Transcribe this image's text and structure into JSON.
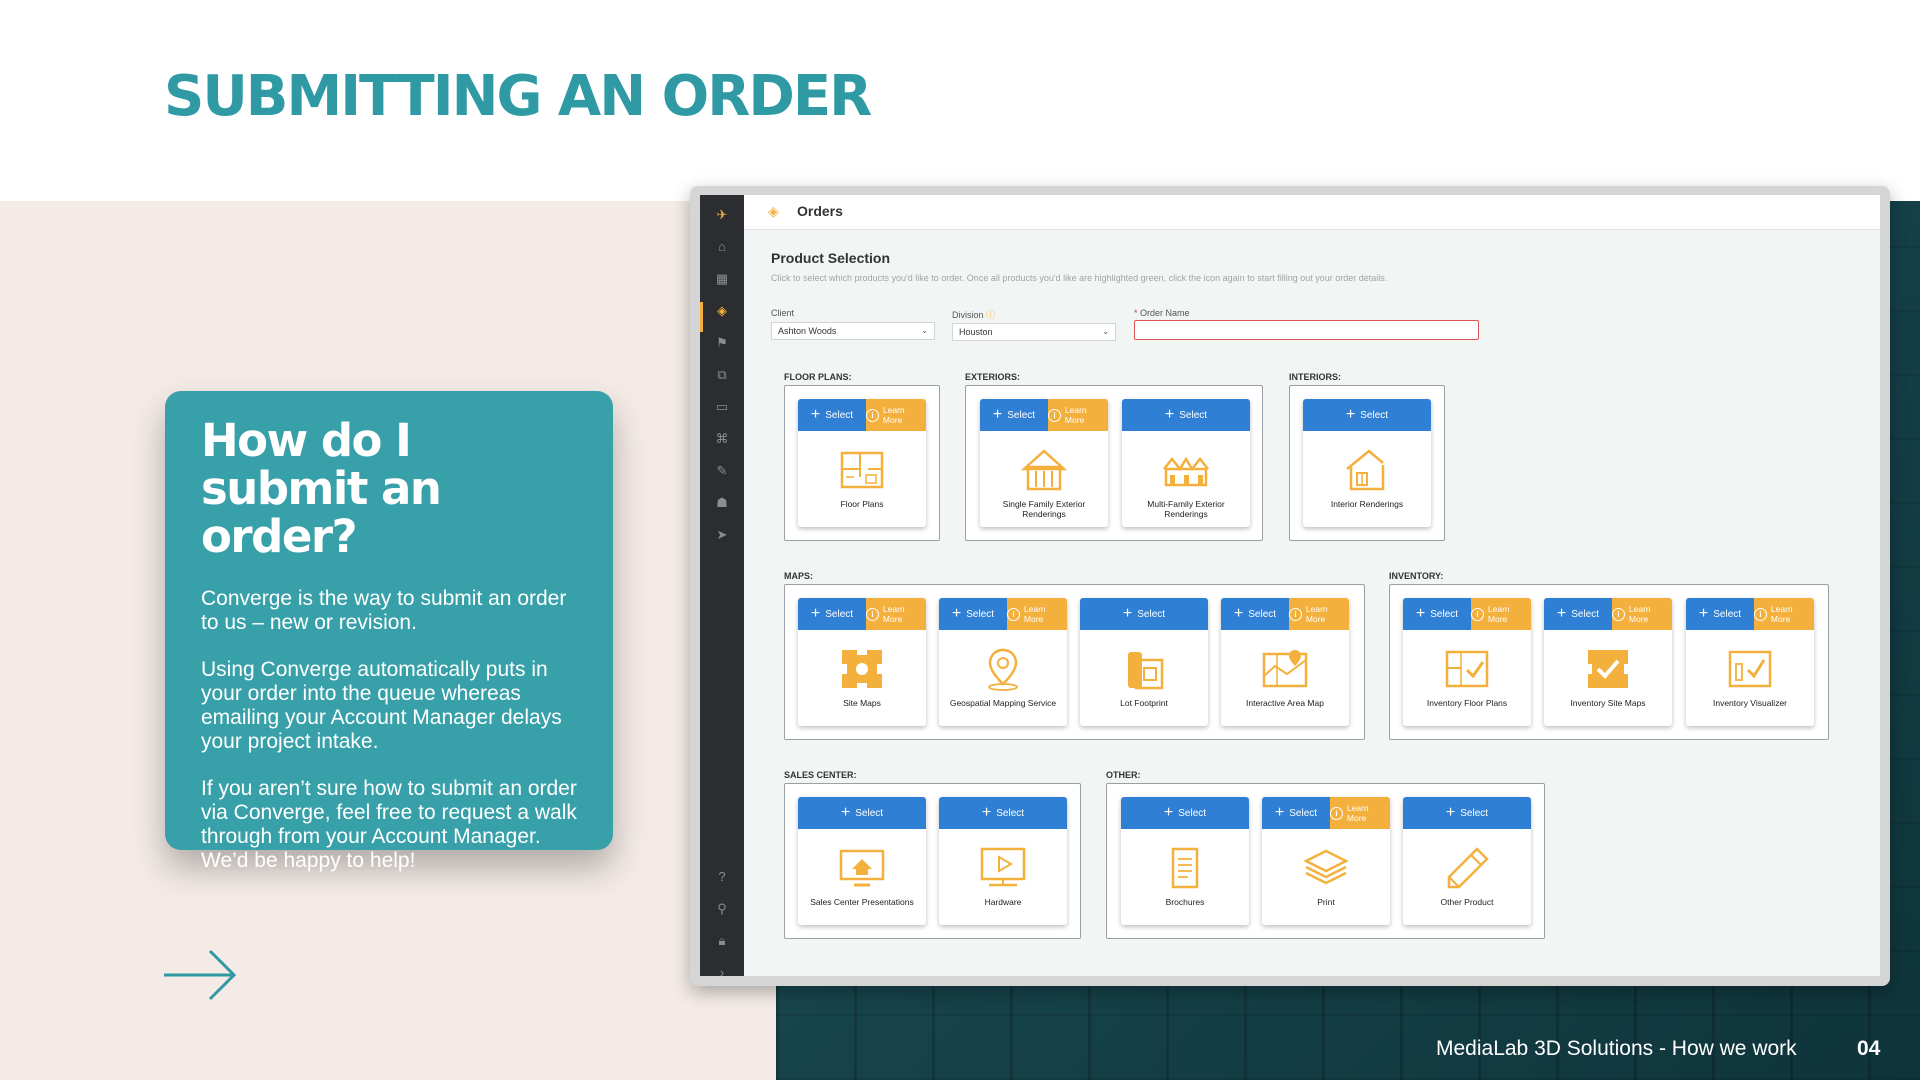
{
  "slide": {
    "title": "SUBMITTING AN ORDER",
    "footer": "MediaLab 3D Solutions - How we work",
    "page_number": "04"
  },
  "info_card": {
    "heading": "How do I submit an order?",
    "paragraphs": [
      "Converge is the way to submit an order to us – new or revision.",
      "Using Converge automatically puts in your order into the queue whereas emailing your Account Manager delays your project intake.",
      "If you aren’t sure how to submit an order via Converge, feel free to request a walk through from your Account Manager. We’d be happy to help!"
    ]
  },
  "app": {
    "page_title": "Orders",
    "section_title": "Product Selection",
    "instructions": "Click to select which products you'd like to order. Once all products you'd like are highlighted green, click the icon again to start filling out your order details.",
    "form": {
      "client_label": "Client",
      "client_value": "Ashton Woods",
      "division_label": "Division",
      "division_value": "Houston",
      "order_name_label": "Order Name",
      "order_name_value": ""
    },
    "select_label": "Select",
    "learn_label": "Learn More",
    "groups": {
      "floor_plans": {
        "label": "FLOOR PLANS:",
        "products": [
          {
            "name": "Floor Plans",
            "learn": true,
            "icon": "floor-plan-icon"
          }
        ]
      },
      "exteriors": {
        "label": "EXTERIORS:",
        "products": [
          {
            "name": "Single Family Exterior Renderings",
            "learn": true,
            "icon": "single-family-icon"
          },
          {
            "name": "Multi-Family Exterior Renderings",
            "learn": false,
            "icon": "multi-family-icon"
          }
        ]
      },
      "interiors": {
        "label": "INTERIORS:",
        "products": [
          {
            "name": "Interior Renderings",
            "learn": false,
            "icon": "interior-icon"
          }
        ]
      },
      "maps": {
        "label": "MAPS:",
        "products": [
          {
            "name": "Site Maps",
            "learn": true,
            "icon": "site-map-icon"
          },
          {
            "name": "Geospatial Mapping Service",
            "learn": true,
            "icon": "geospatial-icon"
          },
          {
            "name": "Lot Footprint",
            "learn": false,
            "icon": "lot-footprint-icon"
          },
          {
            "name": "Interactive Area Map",
            "learn": true,
            "icon": "interactive-map-icon"
          }
        ]
      },
      "inventory": {
        "label": "INVENTORY:",
        "products": [
          {
            "name": "Inventory Floor Plans",
            "learn": true,
            "icon": "inventory-floor-plan-icon"
          },
          {
            "name": "Inventory Site Maps",
            "learn": true,
            "icon": "inventory-site-map-icon"
          },
          {
            "name": "Inventory Visualizer",
            "learn": true,
            "icon": "inventory-visualizer-icon"
          }
        ]
      },
      "sales_center": {
        "label": "SALES CENTER:",
        "products": [
          {
            "name": "Sales Center Presentations",
            "learn": false,
            "icon": "presentation-icon"
          },
          {
            "name": "Hardware",
            "learn": false,
            "icon": "hardware-icon"
          }
        ]
      },
      "other": {
        "label": "OTHER:",
        "products": [
          {
            "name": "Brochures",
            "learn": false,
            "icon": "brochure-icon"
          },
          {
            "name": "Print",
            "learn": true,
            "icon": "print-icon"
          },
          {
            "name": "Other Product",
            "learn": false,
            "icon": "pencil-icon"
          }
        ]
      }
    }
  },
  "colors": {
    "title_teal": "#2f9aa4",
    "card_teal": "#37a0a8",
    "select_blue": "#2f7fd4",
    "learn_orange": "#f4b03c",
    "icon_orange": "#f4b03c"
  }
}
